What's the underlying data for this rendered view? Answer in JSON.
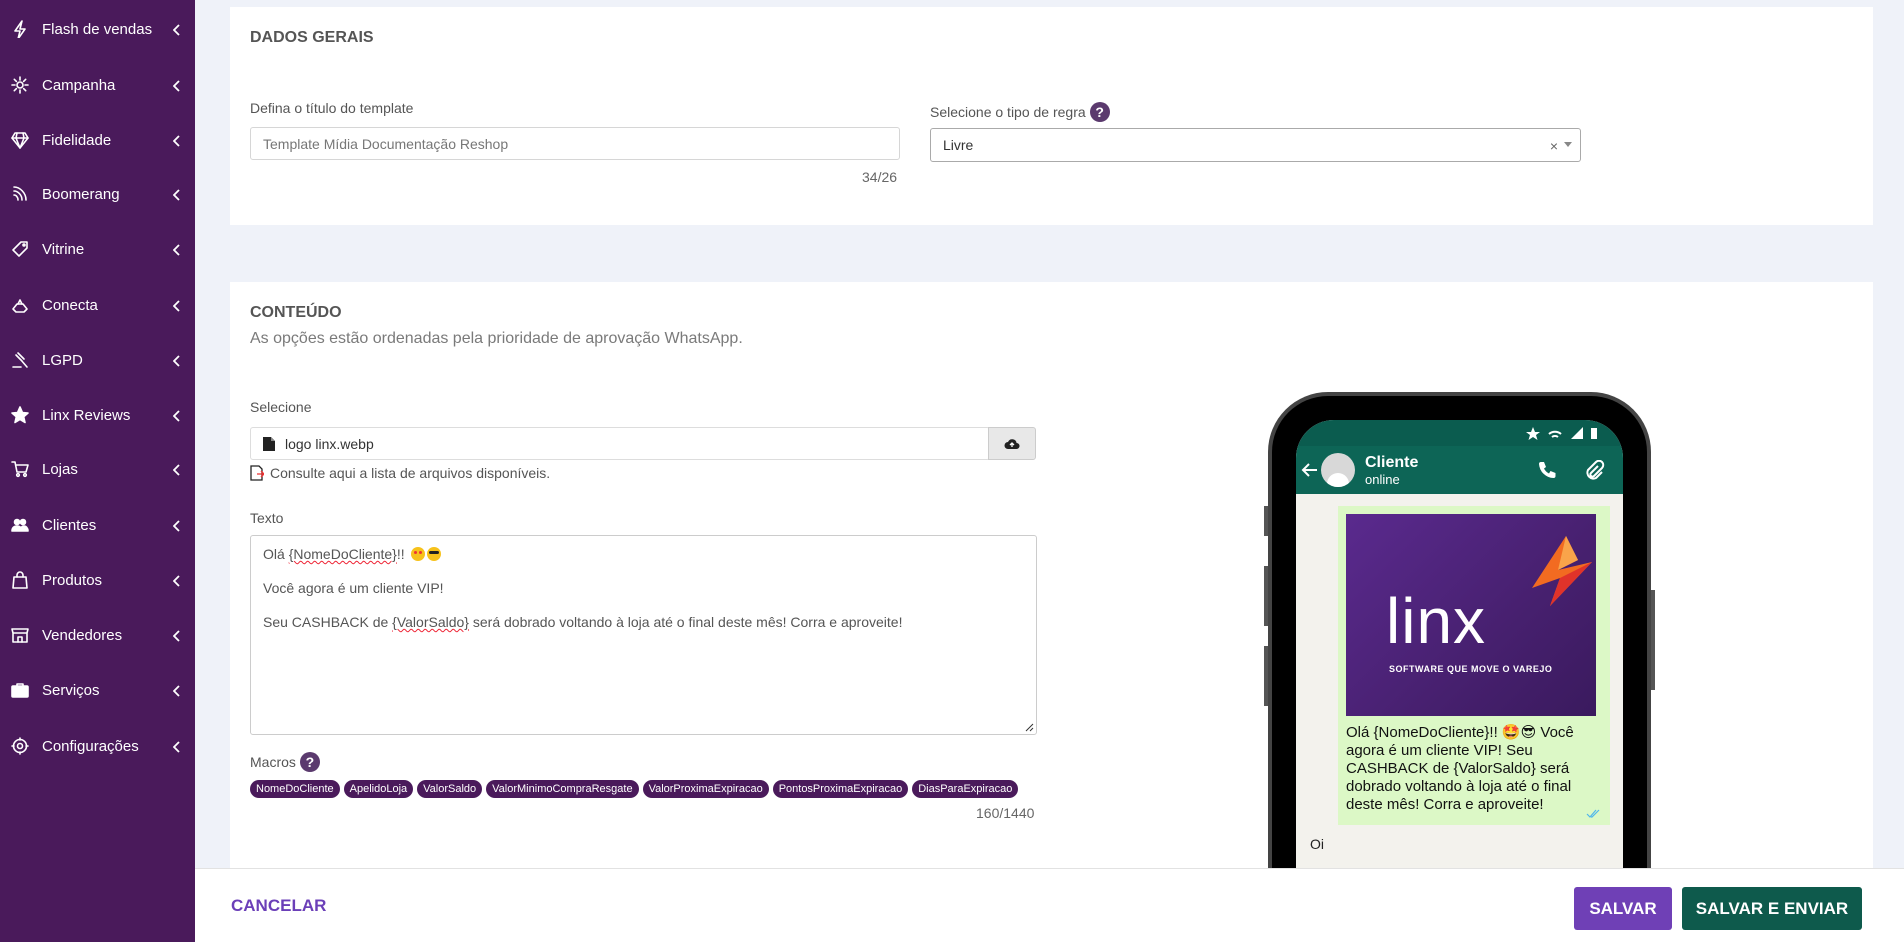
{
  "sidebar": {
    "items": [
      {
        "label": "Flash de vendas",
        "icon": "lightning-icon"
      },
      {
        "label": "Campanha",
        "icon": "gear-icon"
      },
      {
        "label": "Fidelidade",
        "icon": "diamond-icon"
      },
      {
        "label": "Boomerang",
        "icon": "boomerang-icon"
      },
      {
        "label": "Vitrine",
        "icon": "tag-icon"
      },
      {
        "label": "Conecta",
        "icon": "handshake-icon"
      },
      {
        "label": "LGPD",
        "icon": "gavel-icon"
      },
      {
        "label": "Linx Reviews",
        "icon": "star-icon"
      },
      {
        "label": "Lojas",
        "icon": "cart-icon"
      },
      {
        "label": "Clientes",
        "icon": "users-icon"
      },
      {
        "label": "Produtos",
        "icon": "bag-icon"
      },
      {
        "label": "Vendedores",
        "icon": "store-icon"
      },
      {
        "label": "Serviços",
        "icon": "briefcase-icon"
      },
      {
        "label": "Configurações",
        "icon": "settings-icon"
      }
    ]
  },
  "dados_gerais": {
    "title": "DADOS GERAIS",
    "template_title_label": "Defina o título do template",
    "template_title_value": "Template Mídia Documentação Reshop",
    "template_title_counter": "34/26",
    "rule_type_label": "Selecione o tipo de regra",
    "rule_type_value": "Livre",
    "help_glyph": "?",
    "clear_glyph": "×"
  },
  "conteudo": {
    "title": "CONTEÚDO",
    "subtitle": "As opções estão ordenadas pela prioridade de aprovação WhatsApp.",
    "select_label": "Selecione",
    "file_name": "logo linx.webp",
    "consult_link": "Consulte aqui a lista de arquivos disponíveis.",
    "text_label": "Texto",
    "text_line1_prefix": "Olá ",
    "text_line1_macro": "{NomeDoCliente}",
    "text_line1_suffix": "!!",
    "text_line2": "Você agora é um cliente VIP!",
    "text_line3_prefix": "Seu CASHBACK de ",
    "text_line3_macro": "{ValorSaldo}",
    "text_line3_suffix": " será dobrado voltando à loja até o final deste mês! Corra e aproveite!",
    "macros_label": "Macros",
    "macros": [
      "NomeDoCliente",
      "ApelidoLoja",
      "ValorSaldo",
      "ValorMinimoCompraResgate",
      "ValorProximaExpiracao",
      "PontosProximaExpiracao",
      "DiasParaExpiracao"
    ],
    "text_counter": "160/1440"
  },
  "phone_preview": {
    "contact_name": "Cliente",
    "contact_status": "online",
    "logo_word": "linx",
    "logo_tagline": "SOFTWARE QUE MOVE O VAREJO",
    "message_text": "Olá {NomeDoCliente}!! 🤩😎 Você agora é um cliente VIP! Seu CASHBACK de {ValorSaldo} será dobrado voltando à loja até o final deste mês! Corra e aproveite!",
    "reply_text": "Oi"
  },
  "footer": {
    "cancel_label": "CANCELAR",
    "save_label": "SALVAR",
    "save_send_label": "SALVAR E ENVIAR"
  },
  "colors": {
    "sidebar_bg": "#4a1a5b",
    "save_button": "#6f40b6",
    "save_send_button": "#0e5a4c",
    "whatsapp_header": "#0d6556",
    "chip_bg": "#4a1a5b"
  }
}
